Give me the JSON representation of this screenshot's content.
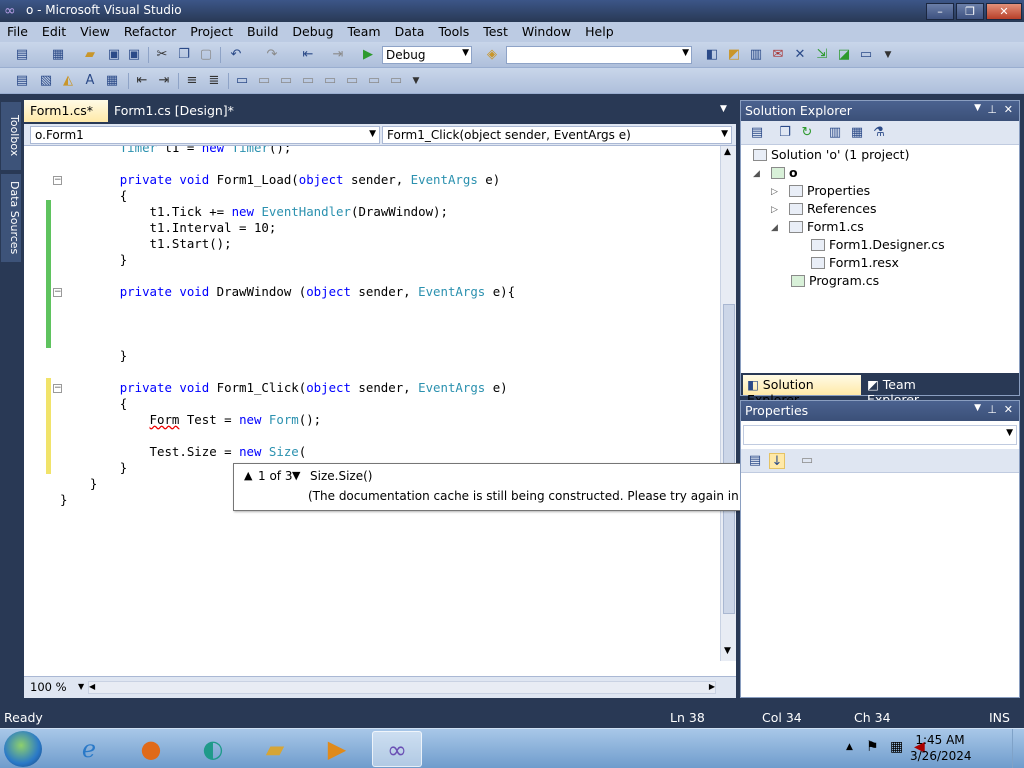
{
  "window": {
    "title": "o - Microsoft Visual Studio",
    "buttons": {
      "minimize": "–",
      "maximize": "❐",
      "close": "✕"
    }
  },
  "menu": [
    "File",
    "Edit",
    "View",
    "Refactor",
    "Project",
    "Build",
    "Debug",
    "Team",
    "Data",
    "Tools",
    "Test",
    "Window",
    "Help"
  ],
  "toolbar": {
    "config": "Debug",
    "platform": ""
  },
  "left_tabs": {
    "toolbox": "Toolbox",
    "data_sources": "Data Sources"
  },
  "doc_tabs": [
    {
      "label": "Form1.cs*",
      "active": true
    },
    {
      "label": "Form1.cs [Design]*",
      "active": false
    }
  ],
  "nav": {
    "type_combo": "o.Form1",
    "member_combo": "Form1_Click(object sender, EventArgs e)"
  },
  "editor": {
    "zoom": "100 %",
    "lines": [
      {
        "indent": "        ",
        "parts": [
          [
            "ty",
            "Timer"
          ],
          [
            "t",
            " t1 = "
          ],
          [
            "kw",
            "new"
          ],
          [
            "t",
            " "
          ],
          [
            "ty",
            "Timer"
          ],
          [
            "t",
            "();"
          ]
        ]
      },
      {
        "indent": "",
        "parts": []
      },
      {
        "indent": "        ",
        "parts": [
          [
            "kw",
            "private"
          ],
          [
            "t",
            " "
          ],
          [
            "kw",
            "void"
          ],
          [
            "t",
            " Form1_Load("
          ],
          [
            "kw",
            "object"
          ],
          [
            "t",
            " sender, "
          ],
          [
            "ty",
            "EventArgs"
          ],
          [
            "t",
            " e)"
          ]
        ]
      },
      {
        "indent": "        ",
        "parts": [
          [
            "t",
            "{"
          ]
        ]
      },
      {
        "indent": "            ",
        "parts": [
          [
            "t",
            "t1.Tick += "
          ],
          [
            "kw",
            "new"
          ],
          [
            "t",
            " "
          ],
          [
            "ty",
            "EventHandler"
          ],
          [
            "t",
            "(DrawWindow);"
          ]
        ]
      },
      {
        "indent": "            ",
        "parts": [
          [
            "t",
            "t1.Interval = 10;"
          ]
        ]
      },
      {
        "indent": "            ",
        "parts": [
          [
            "t",
            "t1.Start();"
          ]
        ]
      },
      {
        "indent": "        ",
        "parts": [
          [
            "t",
            "}"
          ]
        ]
      },
      {
        "indent": "",
        "parts": []
      },
      {
        "indent": "        ",
        "parts": [
          [
            "kw",
            "private"
          ],
          [
            "t",
            " "
          ],
          [
            "kw",
            "void"
          ],
          [
            "t",
            " DrawWindow ("
          ],
          [
            "kw",
            "object"
          ],
          [
            "t",
            " sender, "
          ],
          [
            "ty",
            "EventArgs"
          ],
          [
            "t",
            " e){"
          ]
        ]
      },
      {
        "indent": "",
        "parts": []
      },
      {
        "indent": "",
        "parts": []
      },
      {
        "indent": "",
        "parts": []
      },
      {
        "indent": "        ",
        "parts": [
          [
            "t",
            "}"
          ]
        ]
      },
      {
        "indent": "",
        "parts": []
      },
      {
        "indent": "        ",
        "parts": [
          [
            "kw",
            "private"
          ],
          [
            "t",
            " "
          ],
          [
            "kw",
            "void"
          ],
          [
            "t",
            " Form1_Click("
          ],
          [
            "kw",
            "object"
          ],
          [
            "t",
            " sender, "
          ],
          [
            "ty",
            "EventArgs"
          ],
          [
            "t",
            " e)"
          ]
        ]
      },
      {
        "indent": "        ",
        "parts": [
          [
            "t",
            "{"
          ]
        ]
      },
      {
        "indent": "            ",
        "parts": [
          [
            "err",
            "Form"
          ],
          [
            "t",
            " Test = "
          ],
          [
            "kw",
            "new"
          ],
          [
            "t",
            " "
          ],
          [
            "ty",
            "Form"
          ],
          [
            "t",
            "();"
          ]
        ]
      },
      {
        "indent": "",
        "parts": []
      },
      {
        "indent": "            ",
        "parts": [
          [
            "t",
            "Test.Size = "
          ],
          [
            "kw",
            "new"
          ],
          [
            "t",
            " "
          ],
          [
            "ty",
            "Size"
          ],
          [
            "t",
            "("
          ]
        ]
      },
      {
        "indent": "        ",
        "parts": [
          [
            "t",
            "}"
          ]
        ]
      },
      {
        "indent": "    ",
        "parts": [
          [
            "t",
            "}"
          ]
        ]
      },
      {
        "indent": "",
        "parts": [
          [
            "t",
            "}"
          ]
        ]
      }
    ]
  },
  "tooltip": {
    "counter": "1 of 3",
    "up": "▲",
    "down": "▼",
    "signature": "Size.Size()",
    "message": "(The documentation cache is still being constructed. Please try again in a few seconds.)"
  },
  "solution_explorer": {
    "title": "Solution Explorer",
    "items": [
      {
        "label": "Solution 'o' (1 project)",
        "level": 0
      },
      {
        "label": "o",
        "level": 1,
        "bold": true
      },
      {
        "label": "Properties",
        "level": 2
      },
      {
        "label": "References",
        "level": 2
      },
      {
        "label": "Form1.cs",
        "level": 2
      },
      {
        "label": "Form1.Designer.cs",
        "level": 3
      },
      {
        "label": "Form1.resx",
        "level": 3
      },
      {
        "label": "Program.cs",
        "level": 2
      }
    ],
    "tabs": [
      "Solution Explorer",
      "Team Explorer"
    ]
  },
  "properties": {
    "title": "Properties"
  },
  "status": {
    "text": "Ready",
    "ln": "Ln 38",
    "col": "Col 34",
    "ch": "Ch 34",
    "mode": "INS"
  },
  "taskbar": {
    "time": "1:45 AM",
    "date": "3/26/2024"
  }
}
